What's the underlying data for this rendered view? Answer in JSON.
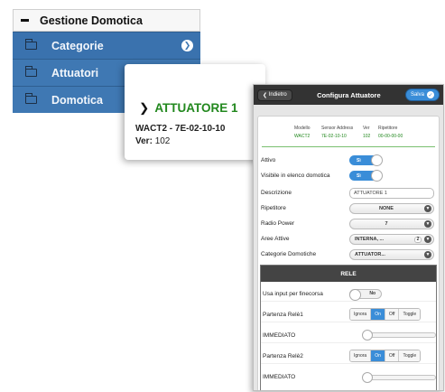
{
  "menu": {
    "header": "Gestione Domotica",
    "items": [
      {
        "label": "Categorie",
        "active": true
      },
      {
        "label": "Attuatori"
      },
      {
        "label": "Domotica"
      }
    ]
  },
  "card": {
    "title": "ATTUATORE 1",
    "line1": "WACT2 - 7E-02-10-10",
    "ver_label": "Ver:",
    "ver_value": "102"
  },
  "phone": {
    "back_label": "Indietro",
    "title": "Configura Attuatore",
    "save_label": "Salva",
    "info": {
      "headers": [
        "Modello",
        "Sensor Address",
        "Ver",
        "Ripetitore"
      ],
      "values": [
        "WACT2",
        "7E-02-10-10",
        "102",
        "00-00-00-00"
      ]
    },
    "fields": {
      "attivo": {
        "label": "Attivo",
        "value": "Sì"
      },
      "visibile": {
        "label": "Visibile in elenco domotica",
        "value": "Sì"
      },
      "descrizione": {
        "label": "Descrizione",
        "value": "ATTUATORE 1"
      },
      "ripetitore": {
        "label": "Ripetitore",
        "value": "NONE"
      },
      "radio_power": {
        "label": "Radio Power",
        "value": "7"
      },
      "aree": {
        "label": "Aree Attive",
        "value": "INTERNA, ...",
        "count": "2"
      },
      "categorie": {
        "label": "Categorie Domotiche",
        "value": "ATTUATOR..."
      }
    },
    "rele": {
      "title": "RELE",
      "finecorsa": {
        "label": "Usa input per finecorsa",
        "value": "No"
      },
      "partenza1": {
        "label": "Partenza Relè1",
        "options": [
          "Ignora",
          "On",
          "Off",
          "Toggle"
        ],
        "selected": "On"
      },
      "immediato1": {
        "label": "IMMEDIATO"
      },
      "partenza2": {
        "label": "Partenza Relè2",
        "options": [
          "Ignora",
          "On",
          "Off",
          "Toggle"
        ],
        "selected": "On"
      },
      "immediato2": {
        "label": "IMMEDIATO"
      }
    }
  },
  "colors": {
    "menu_blue": "#3f78b3",
    "accent_green": "#22881e",
    "toggle_blue": "#3a8dd8",
    "topbar": "#333333"
  }
}
